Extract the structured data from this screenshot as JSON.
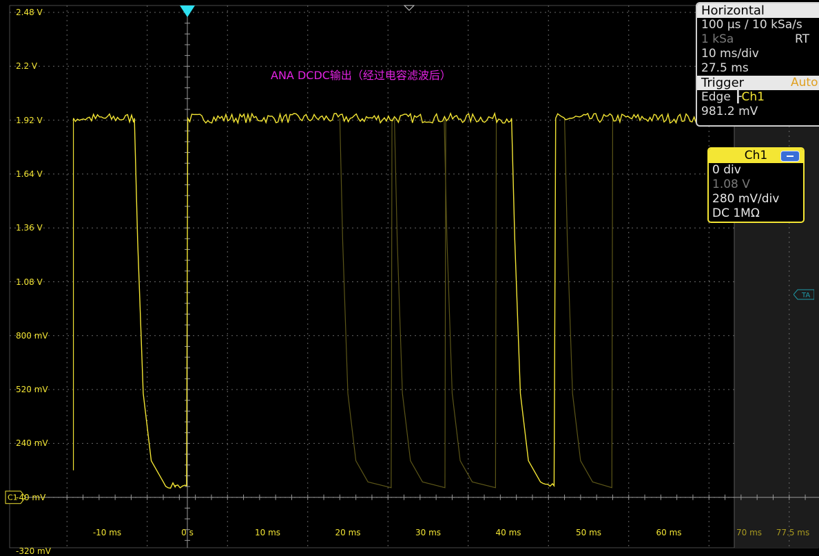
{
  "chart_data": {
    "type": "line",
    "title": "",
    "annotation": "ANA DCDC输出（经过电容滤波后）",
    "xlabel": "",
    "ylabel": "",
    "x_unit": "ms",
    "y_unit": "V",
    "xlim": [
      -15,
      77.5
    ],
    "ylim": [
      -0.32,
      2.48
    ],
    "grid": true,
    "y_tick_labels": [
      "2.48 V",
      "2.2 V",
      "1.92 V",
      "1.64 V",
      "1.36 V",
      "1.08 V",
      "800 mV",
      "520 mV",
      "240 mV",
      "-40 mV",
      "-320 mV"
    ],
    "x_tick_labels": [
      "-10 ms",
      "0 s",
      "10 ms",
      "20 ms",
      "30 ms",
      "40 ms",
      "50 ms",
      "60 ms",
      "70 ms",
      "77.5 ms"
    ],
    "series": [
      {
        "name": "Ch1",
        "color": "#f4e634",
        "high_level": 1.93,
        "low_level": 0.01,
        "points": [
          [
            -14.2,
            1.93
          ],
          [
            -6.6,
            1.93
          ],
          [
            -6.2,
            1.3
          ],
          [
            -5.5,
            0.5
          ],
          [
            -4.5,
            0.15
          ],
          [
            -3.0,
            0.04
          ],
          [
            -1.5,
            0.02
          ],
          [
            -0.1,
            0.02
          ],
          [
            0.05,
            1.93
          ],
          [
            40.4,
            1.93
          ],
          [
            40.8,
            1.3
          ],
          [
            41.5,
            0.5
          ],
          [
            42.5,
            0.15
          ],
          [
            44.0,
            0.04
          ],
          [
            45.7,
            0.02
          ],
          [
            45.9,
            1.93
          ],
          [
            63.5,
            1.93
          ]
        ]
      },
      {
        "name": "Ch1 persistence",
        "color": "#5c5618",
        "pulses": [
          [
            19.0,
            25.5
          ],
          [
            25.8,
            32.2
          ],
          [
            32.0,
            38.5
          ],
          [
            47.0,
            53.0
          ]
        ]
      }
    ]
  },
  "channel_marker": "C1",
  "trigger_arrow_color": "#2ee0f0",
  "horizontal_panel": {
    "title": "Horizontal",
    "rows": [
      "100 µs / 10 kSa/s",
      "1 kSa",
      "10 ms/div",
      "27.5 ms"
    ],
    "rt_label": "RT"
  },
  "trigger_panel": {
    "title": "Trigger",
    "mode": "Auto",
    "type": "Edge",
    "source": "Ch1",
    "level": "981.2 mV"
  },
  "channel_box": {
    "title": "Ch1",
    "rows": [
      "0 div",
      "1.08 V",
      "280 mV/div",
      "DC 1MΩ"
    ]
  },
  "ta_marker": "TA"
}
